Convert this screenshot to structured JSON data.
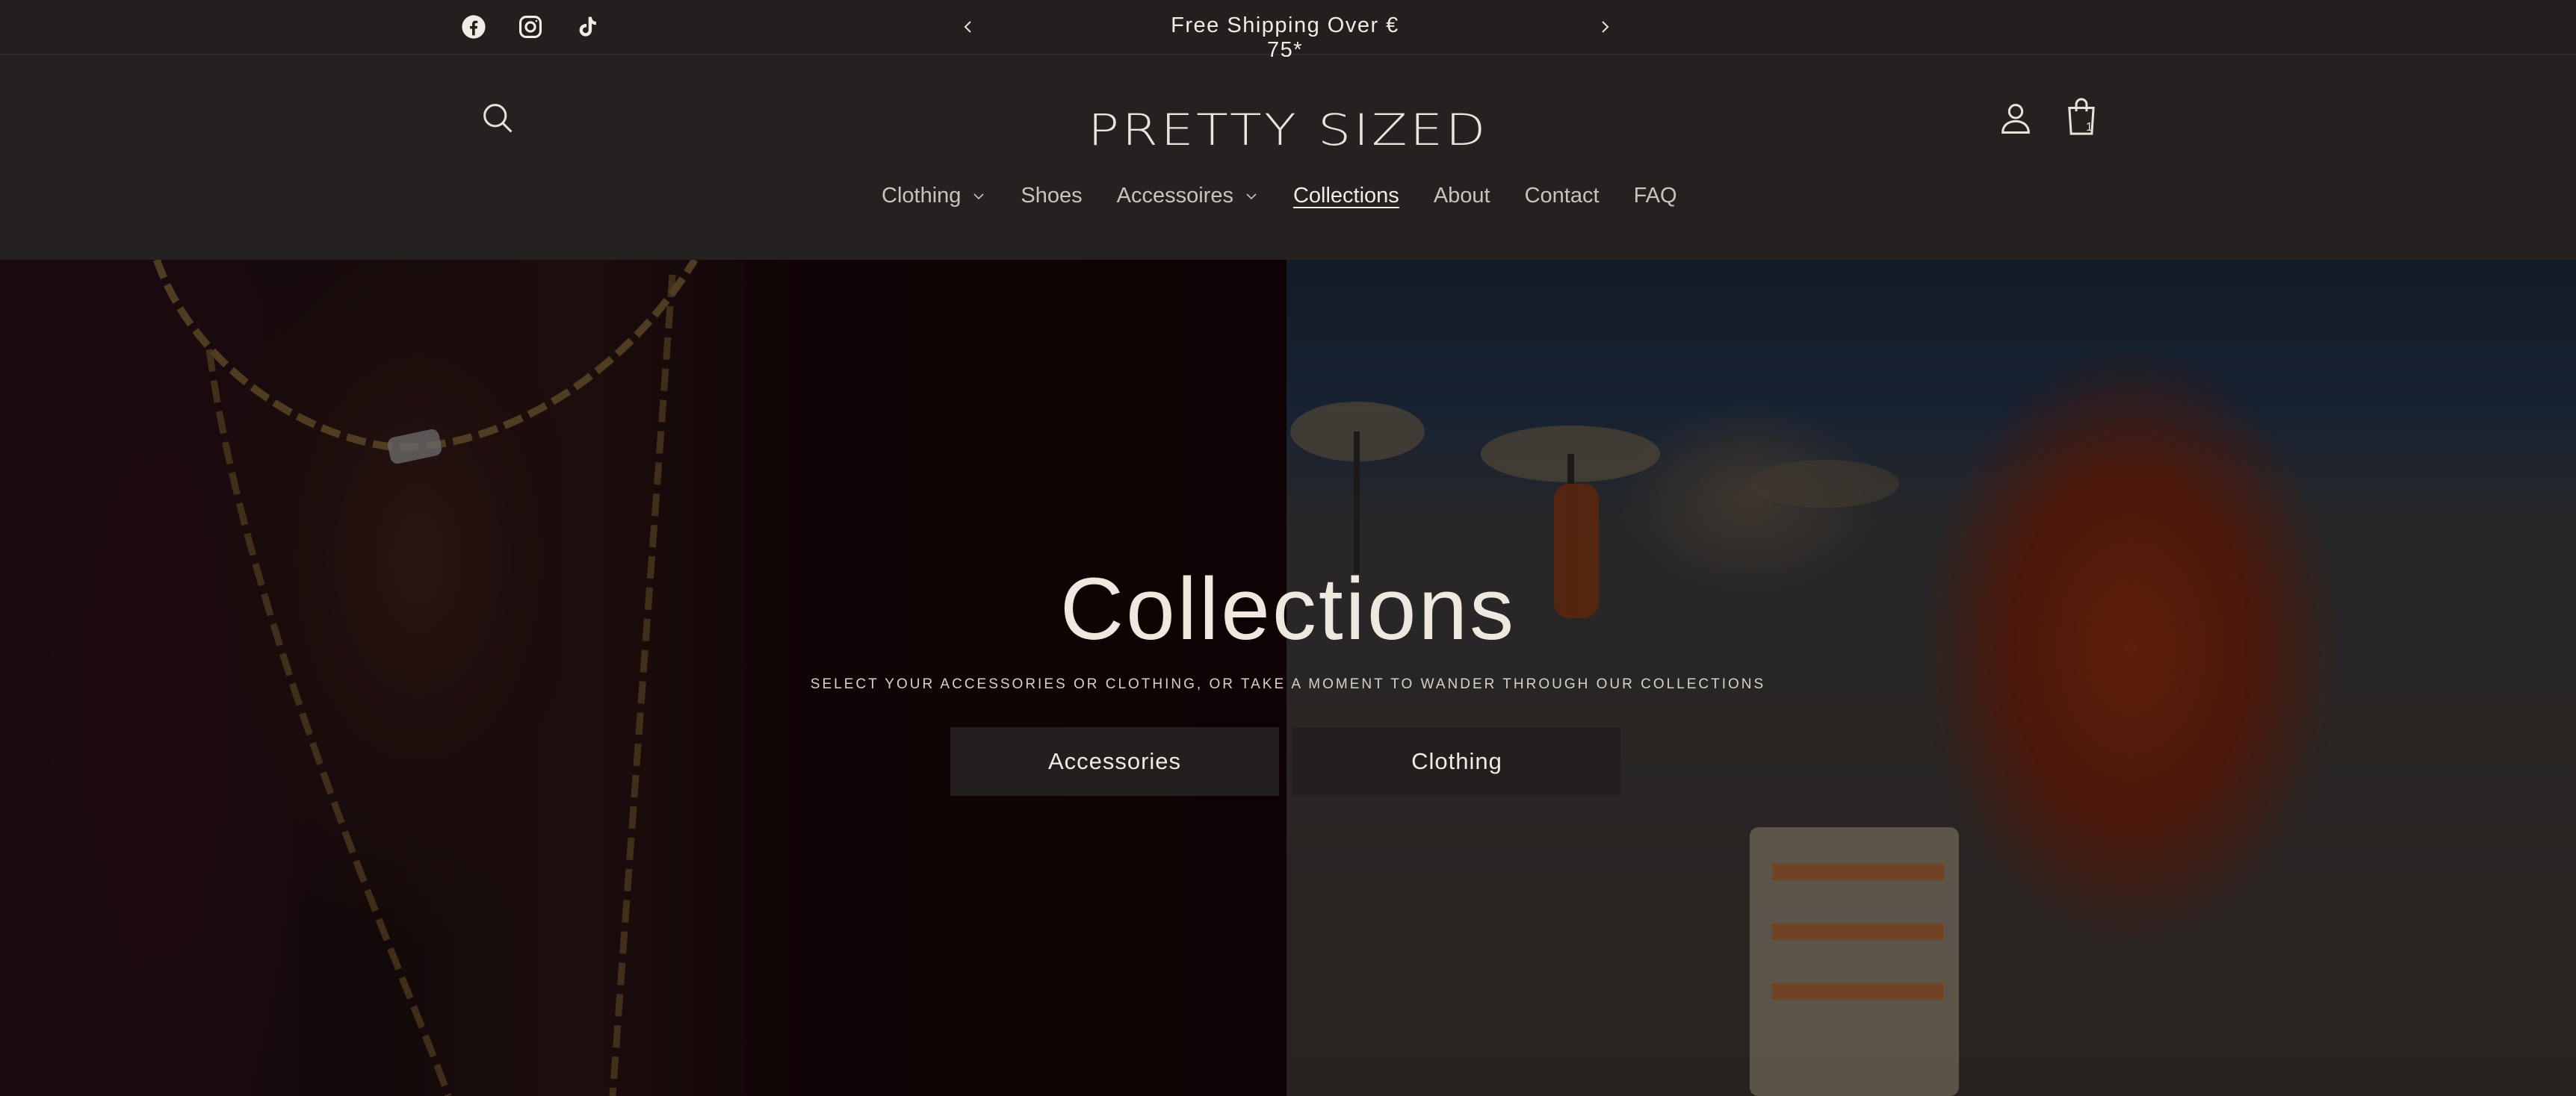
{
  "announcement": {
    "text": "Free Shipping Over € 75*",
    "social": [
      "facebook-icon",
      "instagram-icon",
      "tiktok-icon"
    ],
    "prev_icon": "chevron-left-icon",
    "next_icon": "chevron-right-icon"
  },
  "header": {
    "logo": "PRETTY SIZED",
    "search_icon": "search-icon",
    "account_icon": "account-icon",
    "cart_icon": "cart-icon",
    "cart_count": "1"
  },
  "nav": {
    "items": [
      {
        "label": "Clothing",
        "has_dropdown": true
      },
      {
        "label": "Shoes",
        "has_dropdown": false
      },
      {
        "label": "Accessoires",
        "has_dropdown": true
      },
      {
        "label": "Collections",
        "has_dropdown": false,
        "active": true
      },
      {
        "label": "About",
        "has_dropdown": false
      },
      {
        "label": "Contact",
        "has_dropdown": false
      },
      {
        "label": "FAQ",
        "has_dropdown": false
      }
    ]
  },
  "hero": {
    "title": "Collections",
    "subtitle": "SELECT YOUR ACCESSORIES OR CLOTHING, OR TAKE A MOMENT TO WANDER THROUGH OUR COLLECTIONS",
    "buttons": [
      "Accessories",
      "Clothing"
    ]
  },
  "colors": {
    "background": "#231f1f",
    "text": "#e8e2d8",
    "button": "#231f1f"
  }
}
